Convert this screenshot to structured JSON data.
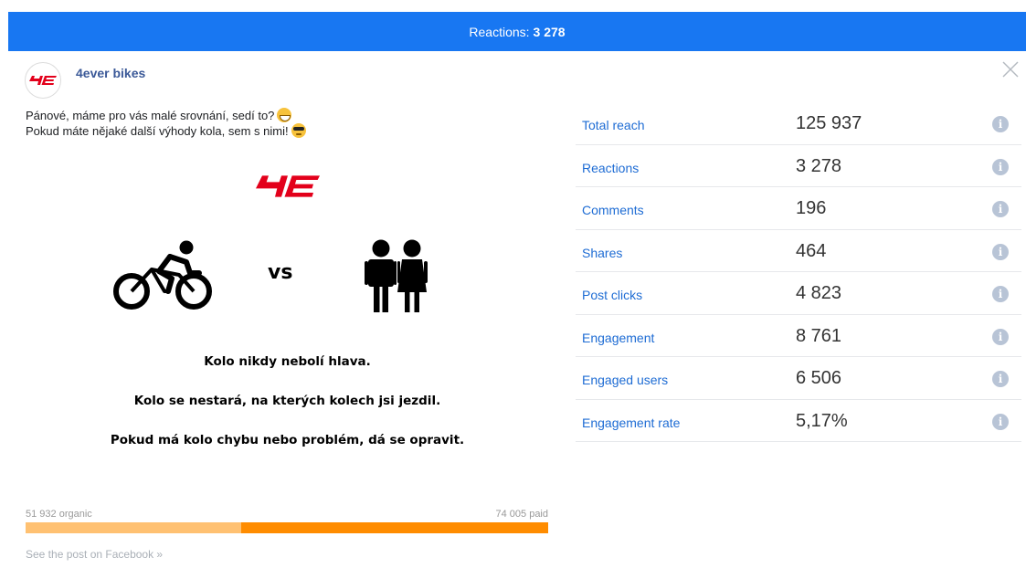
{
  "header": {
    "label": "Reactions:",
    "count": "3 278",
    "color": "#1877f2"
  },
  "post": {
    "page_name": "4ever bikes",
    "text_line1": "Pánové, máme pro vás malé srovnání, sedí to?",
    "text_line2": "Pokud máte nějaké další výhody kola, sem s nimi!",
    "emoji1": "grinning-face",
    "emoji2": "sunglasses-face",
    "image": {
      "logo": "4E",
      "vs": "vs",
      "slogans": [
        "Kolo nikdy nebolí hlava.",
        "Kolo se nestará, na kterých kolech jsi jezdil.",
        "Pokud má kolo chybu nebo problém, dá se opravit."
      ]
    }
  },
  "reach": {
    "organic_label": "51 932 organic",
    "paid_label": "74 005 paid",
    "organic": 51932,
    "paid": 74005,
    "organic_color": "#ffc172",
    "paid_color": "#ff8c00"
  },
  "footer": {
    "link": "See the post on Facebook »"
  },
  "metrics": [
    {
      "label": "Total reach",
      "value": "125 937"
    },
    {
      "label": "Reactions",
      "value": "3 278"
    },
    {
      "label": "Comments",
      "value": "196"
    },
    {
      "label": "Shares",
      "value": "464"
    },
    {
      "label": "Post clicks",
      "value": "4 823"
    },
    {
      "label": "Engagement",
      "value": "8 761"
    },
    {
      "label": "Engaged users",
      "value": "6 506"
    },
    {
      "label": "Engagement rate",
      "value": "5,17%"
    }
  ],
  "icons": {
    "close": "close-icon",
    "info": "info-icon",
    "brand_red": "#e3001b"
  }
}
